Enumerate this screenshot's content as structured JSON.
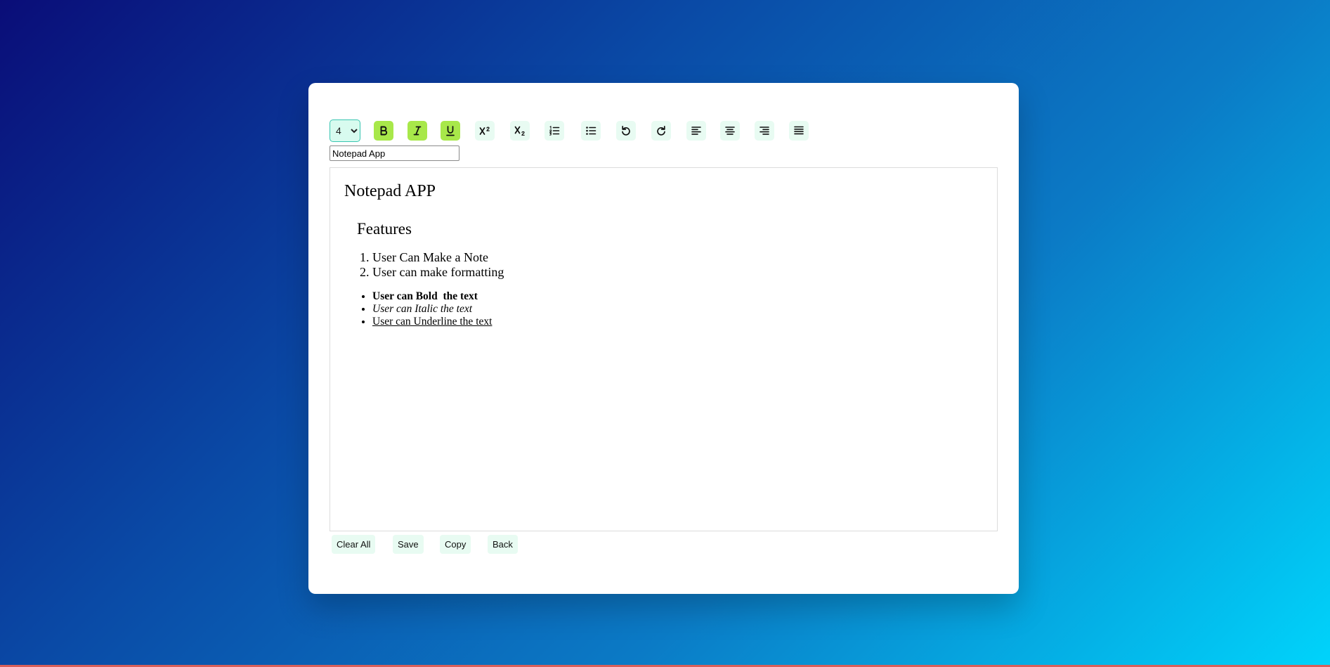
{
  "toolbar": {
    "font_size": {
      "value": "4",
      "options": [
        "1",
        "2",
        "3",
        "4",
        "5",
        "6",
        "7"
      ]
    },
    "buttons": [
      {
        "name": "bold",
        "icon": "bold-icon",
        "active": true
      },
      {
        "name": "italic",
        "icon": "italic-icon",
        "active": true
      },
      {
        "name": "underline",
        "icon": "underline-icon",
        "active": true
      },
      {
        "name": "superscript",
        "icon": "superscript-icon",
        "active": false
      },
      {
        "name": "subscript",
        "icon": "subscript-icon",
        "active": false
      },
      {
        "name": "ordered-list",
        "icon": "ordered-list-icon",
        "active": false
      },
      {
        "name": "unordered-list",
        "icon": "unordered-list-icon",
        "active": false
      },
      {
        "name": "undo",
        "icon": "undo-icon",
        "active": false
      },
      {
        "name": "redo",
        "icon": "redo-icon",
        "active": false
      },
      {
        "name": "align-left",
        "icon": "align-left-icon",
        "active": false
      },
      {
        "name": "align-center",
        "icon": "align-center-icon",
        "active": false
      },
      {
        "name": "align-right",
        "icon": "align-right-icon",
        "active": false
      },
      {
        "name": "justify",
        "icon": "justify-icon",
        "active": false
      }
    ]
  },
  "title_input": {
    "value": "Notepad App"
  },
  "editor": {
    "heading": "Notepad APP",
    "subheading": "Features",
    "ordered": [
      "User Can Make a Note",
      "User can make formatting"
    ],
    "bullets": [
      "User can Bold  the text",
      "User can Italic the text",
      "User can Underline the text"
    ]
  },
  "actions": {
    "clear_all": "Clear All",
    "save": "Save",
    "copy": "Copy",
    "back": "Back"
  },
  "colors": {
    "bg_gradient_start": "#0a0d78",
    "bg_gradient_end": "#00d4fb",
    "active_button": "#a8e84a",
    "button": "#e8fbf2",
    "select_border": "#39c6b1"
  }
}
